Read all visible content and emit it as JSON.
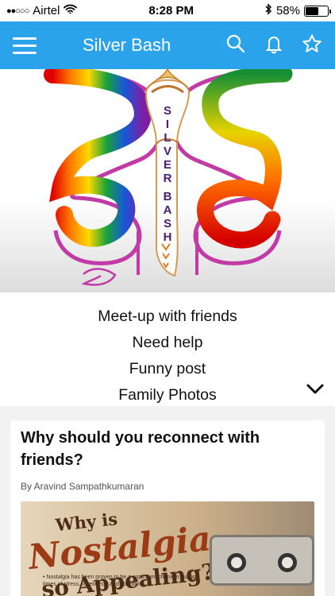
{
  "status": {
    "carrier": "Airtel",
    "signal_bars": "●●○○○",
    "time": "8:28 PM",
    "battery": "58%",
    "battery_level": 0.58
  },
  "app_bar": {
    "title": "Silver Bash",
    "menu_icon": "hamburger-menu-icon",
    "search_icon": "search-icon",
    "notification_icon": "bell-icon",
    "favorite_icon": "star-icon"
  },
  "hero": {
    "letters": [
      "S",
      "I",
      "L",
      "V",
      "E",
      "R",
      "B",
      "A",
      "S",
      "H"
    ]
  },
  "menu": {
    "items": [
      "Meet-up with friends",
      "Need help",
      "Funny post",
      "Family Photos"
    ]
  },
  "article": {
    "title": "Why should you reconnect with friends?",
    "author": "By Aravind Sampathkumaran",
    "image": {
      "line1": "Why is",
      "line2": "Nostalgia",
      "line3": "so Appealing?",
      "bullet": "Nostalgia has been proven to be a coping mechanism during times of stress, loneliness, and boredom."
    }
  }
}
